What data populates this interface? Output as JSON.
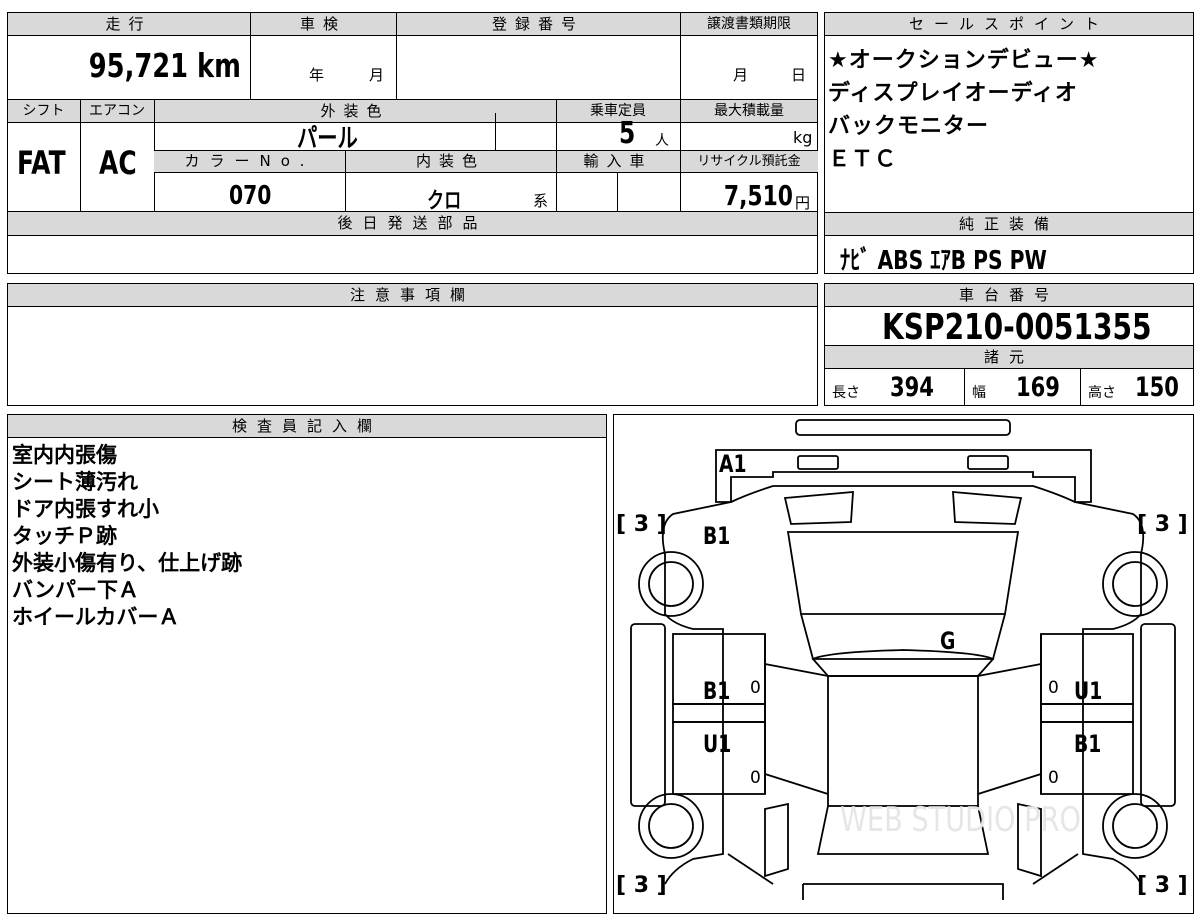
{
  "spec": {
    "mileage_label": "走行",
    "mileage_value": "95,721",
    "mileage_unit": "km",
    "inspection_label": "車検",
    "inspection_year_unit": "年",
    "inspection_month_unit": "月",
    "registration_label": "登録番号",
    "transfer_deadline_label": "譲渡書類期限",
    "transfer_month_unit": "月",
    "transfer_day_unit": "日",
    "shift_label": "シフト",
    "shift_value": "FAT",
    "ac_label": "エアコン",
    "ac_value": "AC",
    "exterior_color_label": "外装色",
    "exterior_color_value": "パール",
    "capacity_label": "乗車定員",
    "capacity_value": "5",
    "capacity_unit": "人",
    "max_load_label": "最大積載量",
    "max_load_unit": "kg",
    "color_no_label": "カラーNo.",
    "color_no_value": "070",
    "interior_color_label": "内装色",
    "interior_color_value": "クロ",
    "interior_color_suffix": "系",
    "import_label": "輸入車",
    "recycle_label": "リサイクル預託金",
    "recycle_value": "7,510",
    "recycle_unit": "円",
    "later_parts_label": "後日発送部品"
  },
  "sales_points": {
    "header": "セールスポイント",
    "lines": [
      "★オークションデビュー★",
      "ディスプレイオーディオ",
      "バックモニター",
      "ＥＴＣ"
    ]
  },
  "equipment": {
    "header": "純正装備",
    "value": "ﾅﾋﾞ ABS ｴｱB PS PW"
  },
  "notes": {
    "header": "注意事項欄"
  },
  "chassis": {
    "header": "車台番号",
    "value": "KSP210-0051355",
    "dims_header": "諸元",
    "length_label": "長さ",
    "length_value": "394",
    "width_label": "幅",
    "width_value": "169",
    "height_label": "高さ",
    "height_value": "150"
  },
  "inspector": {
    "header": "検査員記入欄",
    "lines": [
      "室内内張傷",
      "シート薄汚れ",
      "ドア内張すれ小",
      "タッチＰ跡",
      "外装小傷有り、仕上げ跡",
      "バンパー下Ａ",
      "ホイールカバーＡ"
    ]
  },
  "diagram": {
    "marks": {
      "front_bumper": "A1",
      "hood": "B1",
      "roof_glass": "G",
      "left_front_door": "B1",
      "left_rear_door": "U1",
      "right_front_door": "U1",
      "right_rear_door": "B1",
      "tire_tl": "[ 3 ]",
      "tire_tr": "[ 3 ]",
      "tire_bl": "[ 3 ]",
      "tire_br": "[ 3 ]",
      "zero_mark": "0"
    },
    "watermark": "WEB STUDIO PRO"
  }
}
